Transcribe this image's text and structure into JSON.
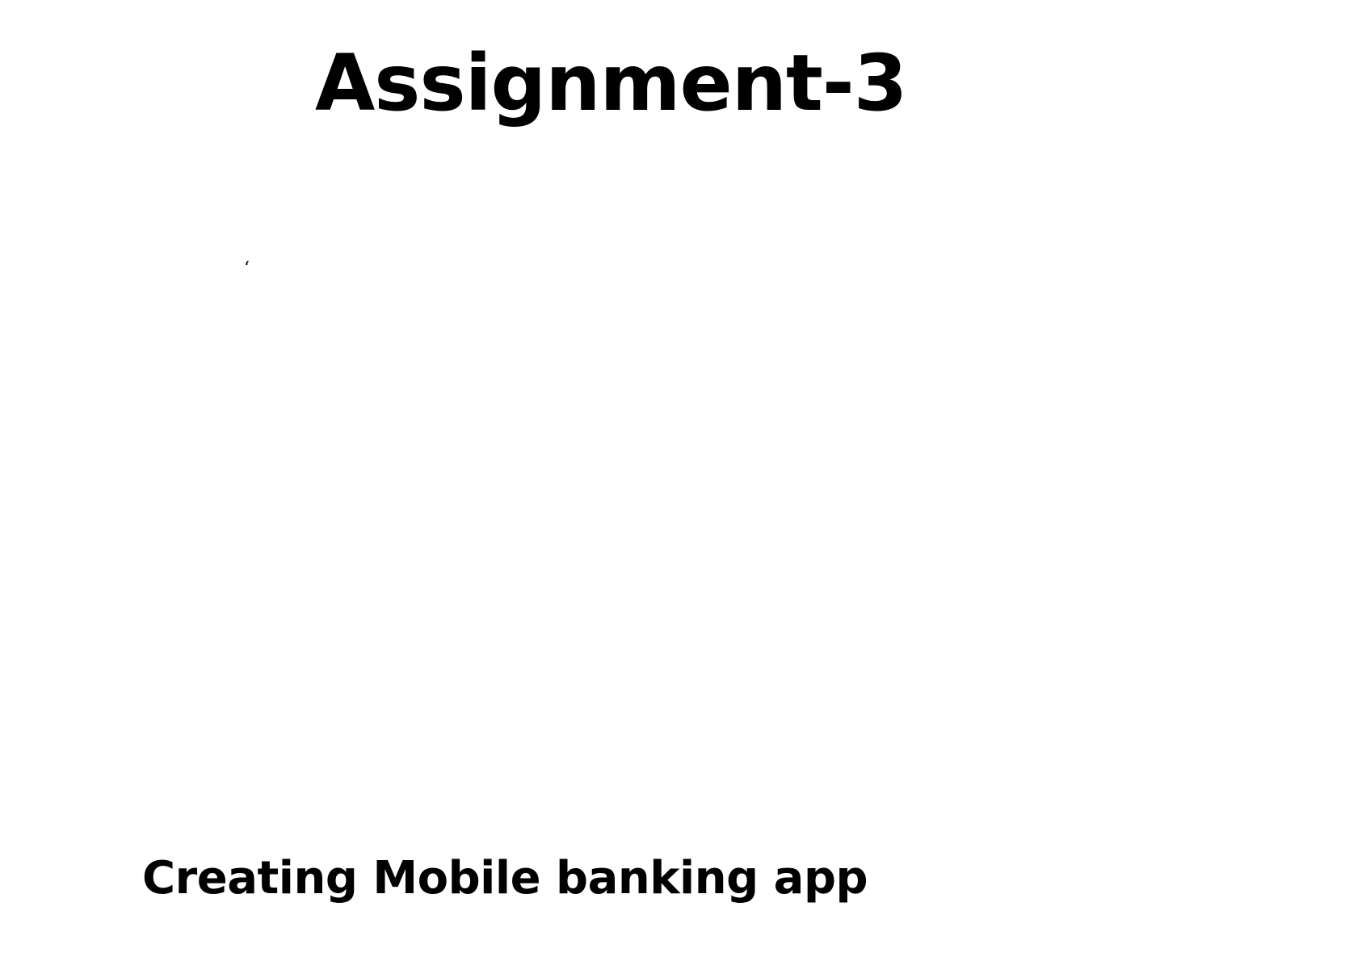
{
  "slide": {
    "title": "Assignment-3",
    "stray_mark": "ʻ",
    "subtitle": "Creating Mobile banking app",
    "background_color": "#ffffff",
    "text_color": "#000000"
  }
}
